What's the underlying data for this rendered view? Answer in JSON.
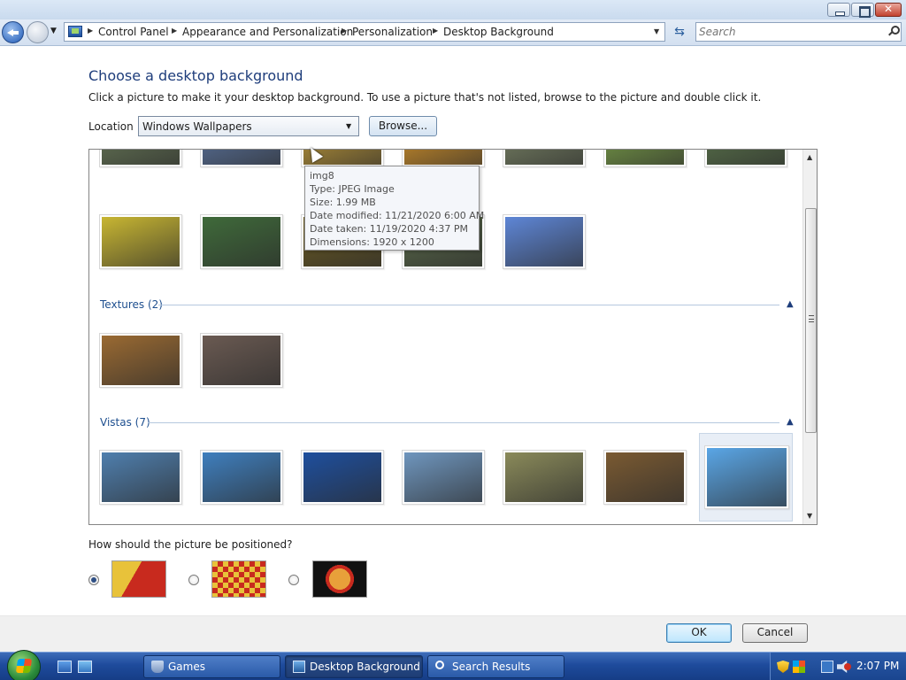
{
  "window": {
    "breadcrumbs": [
      "Control Panel",
      "Appearance and Personalization",
      "Personalization",
      "Desktop Background"
    ],
    "search_placeholder": "Search"
  },
  "page": {
    "title": "Choose a desktop background",
    "subtitle": "Click a picture to make it your desktop background. To use a picture that's not listed, browse to the picture and double click it.",
    "location_label": "Location",
    "location_value": "Windows Wallpapers",
    "browse_label": "Browse..."
  },
  "gallery": {
    "groups": [
      {
        "label": "Textures (2)"
      },
      {
        "label": "Vistas (7)"
      }
    ],
    "tooltip": {
      "name": "img8",
      "type": "Type: JPEG Image",
      "size": "Size: 1.99 MB",
      "modified": "Date modified: 11/21/2020 6:00 AM",
      "taken": "Date taken: 11/19/2020 4:37 PM",
      "dimensions": "Dimensions: 1920 x 1200"
    },
    "colors": {
      "top_row": [
        "#6b7d5a",
        "#5f7aa8",
        "#c9a13a",
        "#e09a2a",
        "#7f8a6a",
        "#7fa74a",
        "#5e7a4e"
      ],
      "flowers_row": [
        "#c8b632",
        "#3f6a3a",
        "#6a5a22",
        "#5a6a4a",
        "#5e86d6"
      ],
      "textures": [
        "#9a6a32",
        "#6a5a52"
      ],
      "vistas": [
        "#4f7fae",
        "#3f7fbe",
        "#1e4f9e",
        "#6f96be",
        "#8a8a5a",
        "#7a5a32",
        "#5aa6e6"
      ]
    }
  },
  "position": {
    "question": "How should the picture be positioned?"
  },
  "buttons": {
    "ok": "OK",
    "cancel": "Cancel"
  },
  "taskbar": {
    "tasks": [
      {
        "label": "Games"
      },
      {
        "label": "Desktop Background"
      },
      {
        "label": "Search Results"
      }
    ],
    "clock": "2:07 PM"
  }
}
